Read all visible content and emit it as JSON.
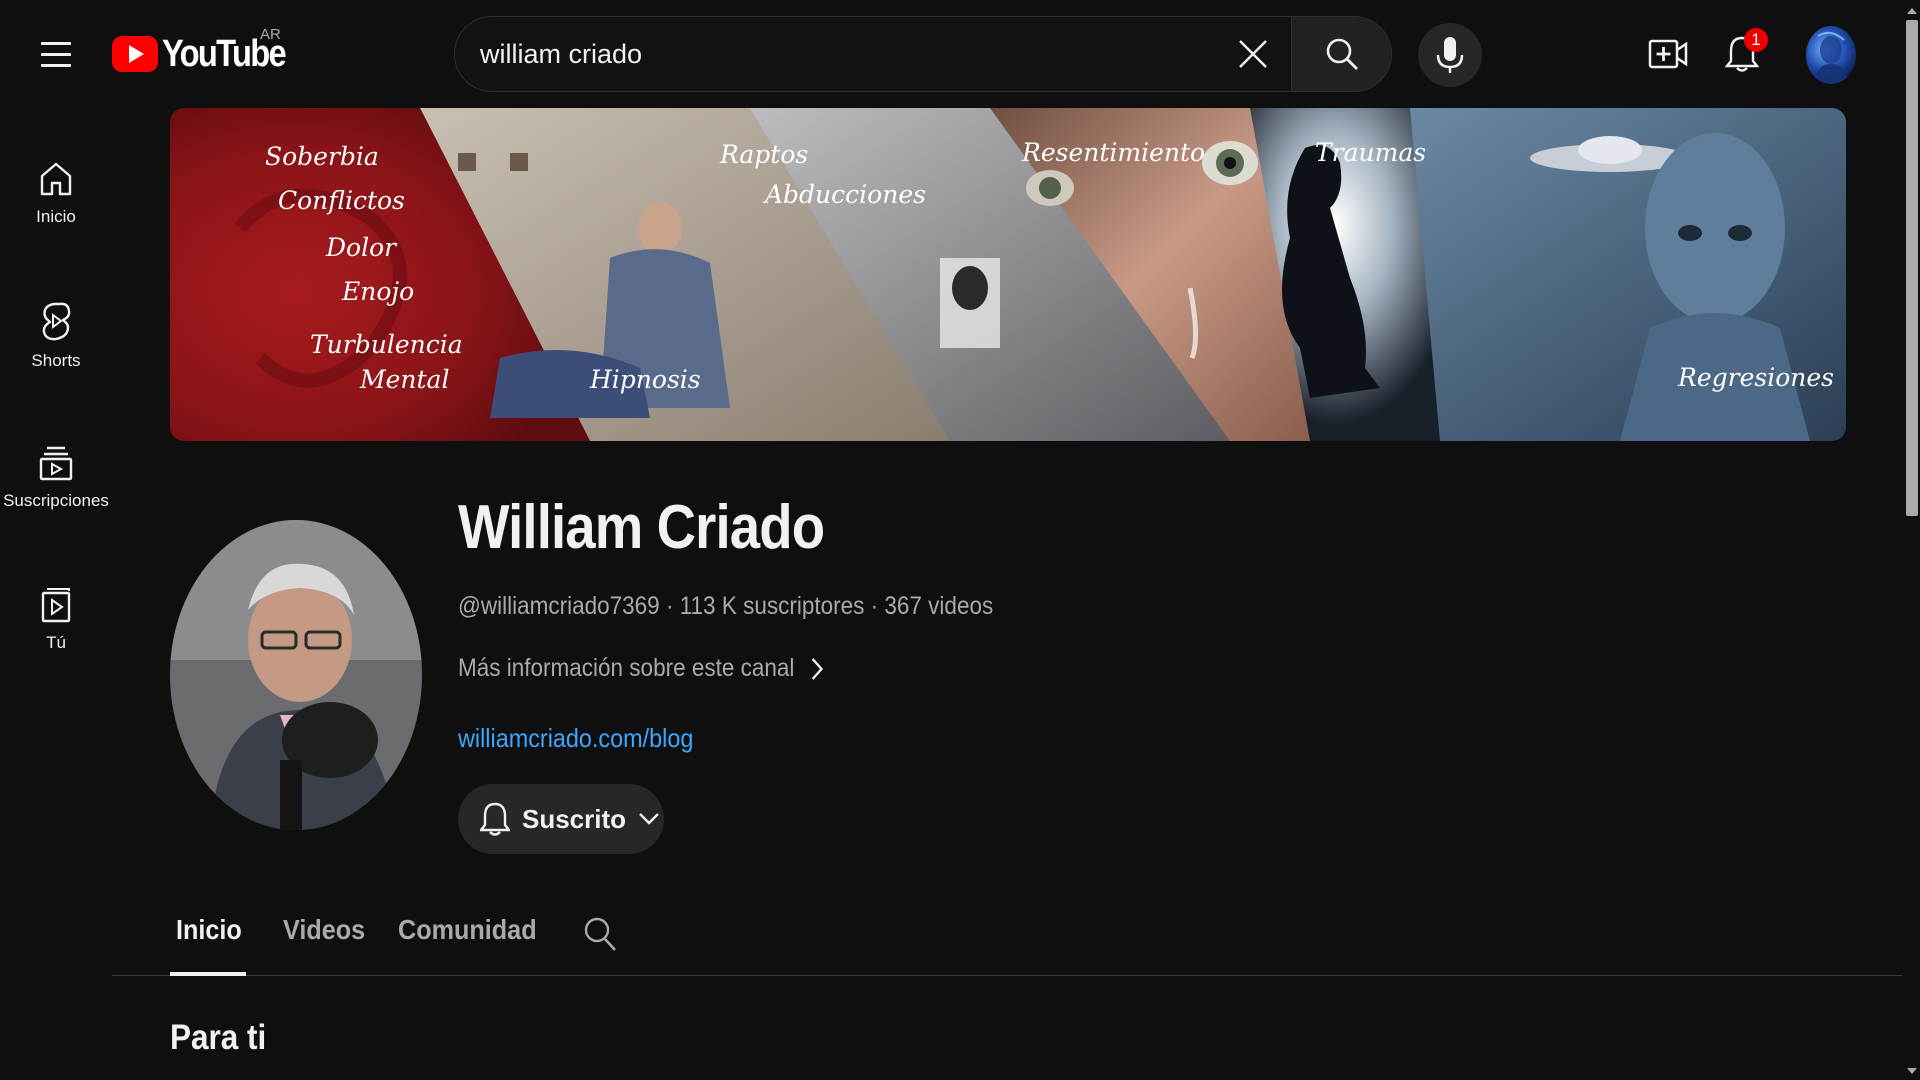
{
  "header": {
    "logo_text": "YouTube",
    "country_code": "AR",
    "search": {
      "value": "william criado",
      "placeholder": "Buscar"
    },
    "notification_count": "1"
  },
  "sidebar": {
    "items": [
      {
        "label": "Inicio",
        "icon": "home-icon"
      },
      {
        "label": "Shorts",
        "icon": "shorts-icon"
      },
      {
        "label": "Suscripciones",
        "icon": "subscriptions-icon"
      },
      {
        "label": "Tú",
        "icon": "you-icon"
      }
    ]
  },
  "banner": {
    "words": [
      "Soberbia",
      "Conflictos",
      "Dolor",
      "Enojo",
      "Turbulencia",
      "Mental",
      "Hipnosis",
      "Raptos",
      "Abducciones",
      "Resentimiento",
      "Traumas",
      "Regresiones"
    ]
  },
  "channel": {
    "name": "William Criado",
    "handle": "@williamcriado7369",
    "subscribers": "113 K suscriptores",
    "videos": "367 videos",
    "more_info": "Más información sobre este canal",
    "link": "williamcriado.com/blog",
    "subscribe_label": "Suscrito"
  },
  "tabs": [
    {
      "label": "Inicio",
      "active": true
    },
    {
      "label": "Videos",
      "active": false
    },
    {
      "label": "Comunidad",
      "active": false
    }
  ],
  "section": {
    "title": "Para ti"
  },
  "colors": {
    "background": "#0f0f0f",
    "brand_red": "#ff0000",
    "link_blue": "#3ea6ff",
    "banner_red": "#8e1418"
  }
}
